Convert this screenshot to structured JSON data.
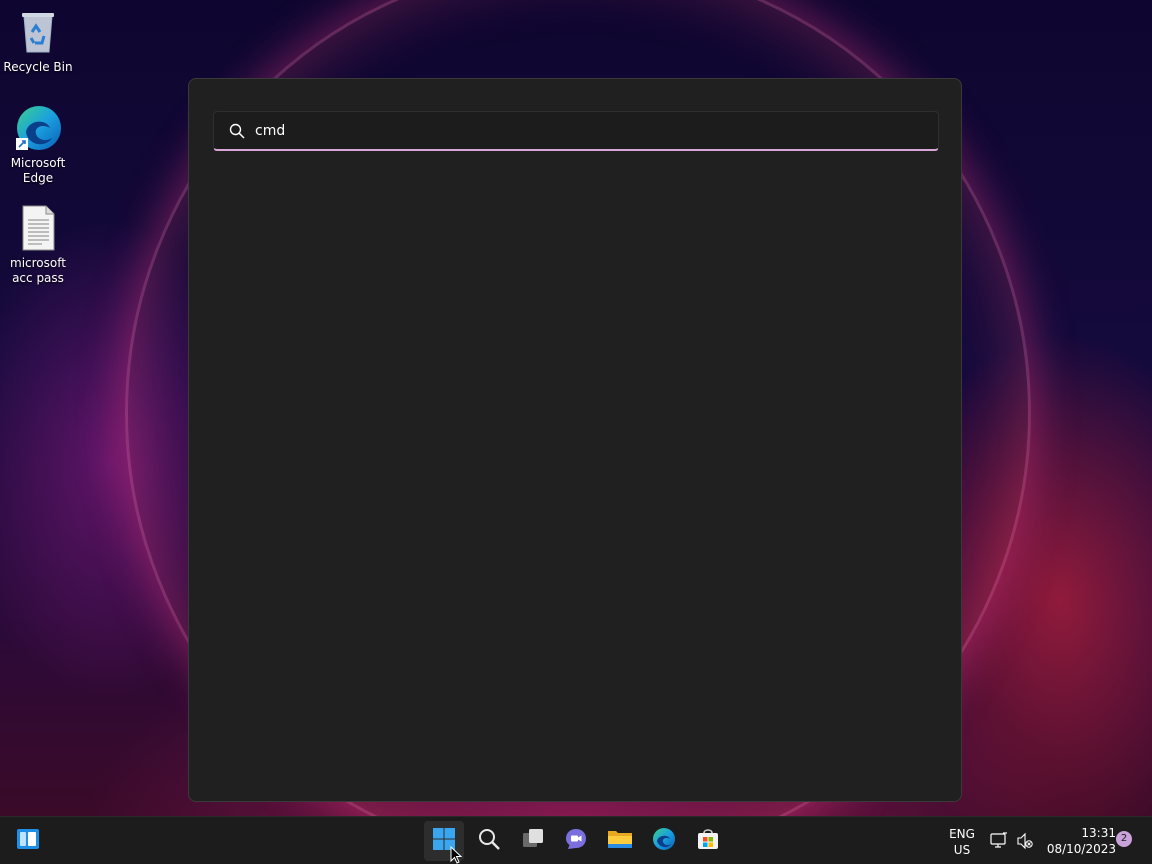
{
  "desktop": {
    "icons": [
      {
        "label": "Recycle Bin"
      },
      {
        "label": "Microsoft Edge"
      },
      {
        "label": "microsoft acc pass"
      }
    ]
  },
  "start": {
    "search_value": "cmd"
  },
  "taskbar": {
    "icons": [
      "widgets-icon",
      "start-icon",
      "search-icon",
      "task-view-icon",
      "teams-chat-icon",
      "file-explorer-icon",
      "edge-icon",
      "store-icon"
    ],
    "language_line1": "ENG",
    "language_line2": "US",
    "time": "13:31",
    "date": "08/10/2023",
    "notification_count": "2"
  },
  "colors": {
    "accent": "#d9a6d9",
    "panel_bg": "#202020",
    "taskbar_bg": "#1c1c1c"
  }
}
